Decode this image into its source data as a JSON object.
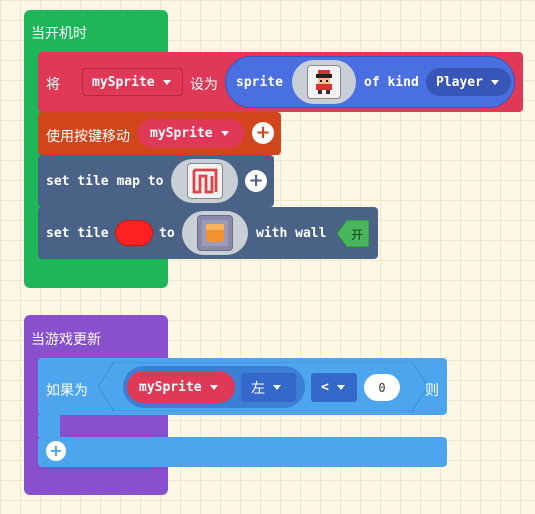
{
  "on_start": {
    "hat_label": "当开机时",
    "set_var": {
      "label": "将",
      "var_name": "mySprite",
      "set_to_label": "设为",
      "sprite_label": "sprite",
      "of_kind_label": "of kind",
      "kind_value": "Player"
    },
    "move_with_buttons": {
      "label": "使用按键移动",
      "sprite_value": "mySprite"
    },
    "set_tile_map": {
      "label": "set tile map to"
    },
    "set_tile": {
      "label": "set tile",
      "to_label": "to",
      "with_wall_label": "with wall",
      "wall_value": "开"
    }
  },
  "on_update": {
    "hat_label": "当游戏更新",
    "if_block": {
      "if_label": "如果为",
      "sprite_value": "mySprite",
      "direction_value": "左",
      "operator_value": "<",
      "number_value": "0",
      "then_label": "则"
    }
  },
  "colors": {
    "events_green": "#1db75a",
    "variables_red": "#e03857",
    "controller_orange": "#d0451b",
    "scene_slate": "#4a6285",
    "loops_purple": "#8850cc",
    "logic_blue": "#4ca5ed"
  },
  "icons": [
    "player-sprite-icon",
    "tilemap-icon",
    "tile-image-icon",
    "add-plus-icon"
  ]
}
